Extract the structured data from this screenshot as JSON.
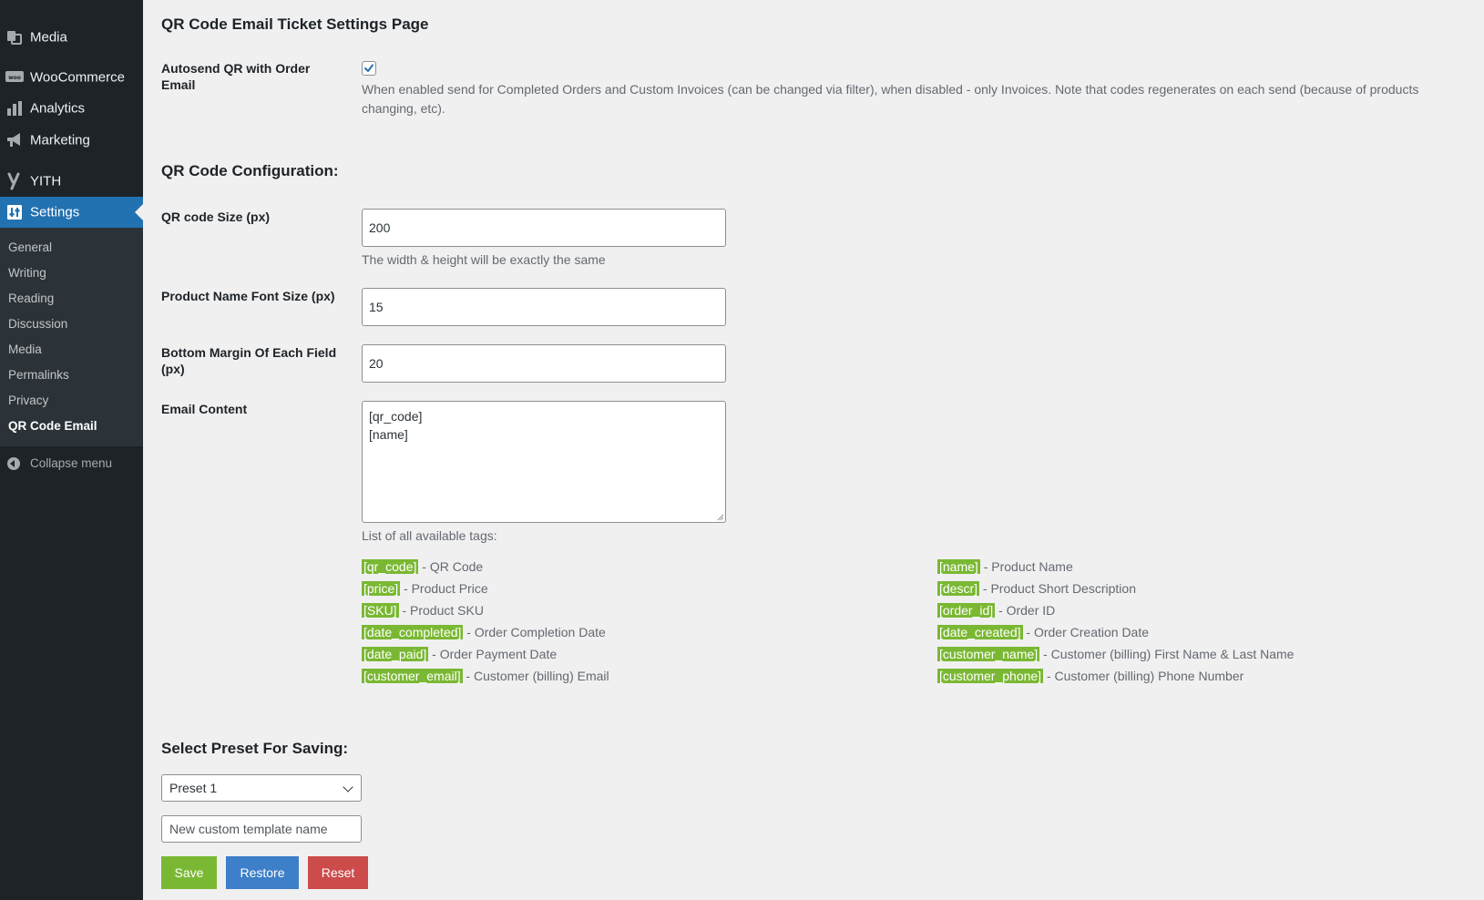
{
  "sidebar": {
    "menu": [
      {
        "label": "Media",
        "icon": "media-icon"
      },
      {
        "label": "WooCommerce",
        "icon": "woocommerce-icon"
      },
      {
        "label": "Analytics",
        "icon": "analytics-icon"
      },
      {
        "label": "Marketing",
        "icon": "megaphone-icon"
      },
      {
        "label": "YITH",
        "icon": "yith-icon"
      },
      {
        "label": "Settings",
        "icon": "settings-icon"
      }
    ],
    "submenu": [
      "General",
      "Writing",
      "Reading",
      "Discussion",
      "Media",
      "Permalinks",
      "Privacy",
      "QR Code Email"
    ],
    "collapse_label": "Collapse menu"
  },
  "main": {
    "page_title": "QR Code Email Ticket Settings Page",
    "autosend": {
      "label": "Autosend QR with Order Email",
      "checked": true,
      "description": "When enabled send for Completed Orders and Custom Invoices (can be changed via filter), when disabled - only Invoices. Note that codes regenerates on each send (because of products changing, etc)."
    },
    "config_title": "QR Code Configuration:",
    "qr_size": {
      "label": "QR code Size (px)",
      "value": "200",
      "description": "The width & height will be exactly the same"
    },
    "font_size": {
      "label": "Product Name Font Size (px)",
      "value": "15"
    },
    "bottom_margin": {
      "label": "Bottom Margin Of Each Field (px)",
      "value": "20"
    },
    "email_content": {
      "label": "Email Content",
      "value": "[qr_code]\n[name]"
    },
    "tags_intro": "List of all available tags:",
    "tags": [
      {
        "tag": "[qr_code]",
        "desc": " - QR Code"
      },
      {
        "tag": "[name]",
        "desc": " - Product Name"
      },
      {
        "tag": "[price]",
        "desc": " - Product Price"
      },
      {
        "tag": "[descr]",
        "desc": " - Product Short Description"
      },
      {
        "tag": "[SKU]",
        "desc": " - Product SKU"
      },
      {
        "tag": "[order_id]",
        "desc": " - Order ID"
      },
      {
        "tag": "[date_completed]",
        "desc": " - Order Completion Date"
      },
      {
        "tag": "[date_created]",
        "desc": " - Order Creation Date"
      },
      {
        "tag": "[date_paid]",
        "desc": " - Order Payment Date"
      },
      {
        "tag": "[customer_name]",
        "desc": " - Customer (billing) First Name & Last Name"
      },
      {
        "tag": "[customer_email]",
        "desc": " - Customer (billing) Email"
      },
      {
        "tag": "[customer_phone]",
        "desc": " - Customer (billing) Phone Number"
      }
    ],
    "preset_title": "Select Preset For Saving:",
    "preset_selected": "Preset 1",
    "template_placeholder": "New custom template name",
    "buttons": {
      "save": "Save",
      "restore": "Restore",
      "reset": "Reset"
    }
  },
  "colors": {
    "sidebar_bg": "#1d2327",
    "active_menu": "#2271b1",
    "tag_green": "#7ab833",
    "save_btn": "#7ab833",
    "restore_btn": "#3d7fc8",
    "reset_btn": "#cc4b4b"
  }
}
